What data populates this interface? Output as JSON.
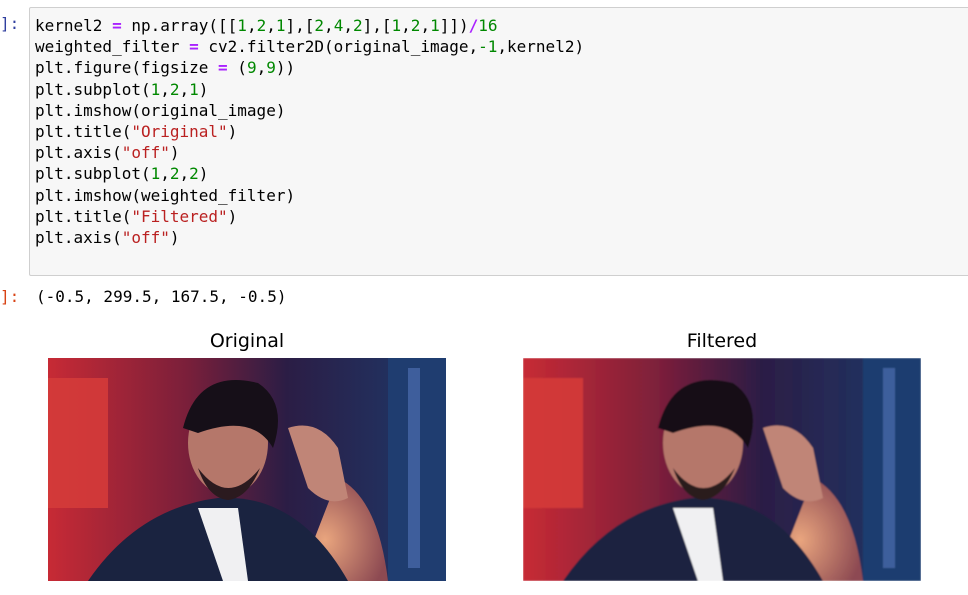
{
  "cell": {
    "in_prompt": "]:",
    "out_prompt": "]:",
    "code_lines": [
      [
        {
          "t": "kernel2 ",
          "c": "plain"
        },
        {
          "t": "=",
          "c": "op"
        },
        {
          "t": " np.array([[",
          "c": "plain"
        },
        {
          "t": "1",
          "c": "num"
        },
        {
          "t": ",",
          "c": "plain"
        },
        {
          "t": "2",
          "c": "num"
        },
        {
          "t": ",",
          "c": "plain"
        },
        {
          "t": "1",
          "c": "num"
        },
        {
          "t": "],[",
          "c": "plain"
        },
        {
          "t": "2",
          "c": "num"
        },
        {
          "t": ",",
          "c": "plain"
        },
        {
          "t": "4",
          "c": "num"
        },
        {
          "t": ",",
          "c": "plain"
        },
        {
          "t": "2",
          "c": "num"
        },
        {
          "t": "],[",
          "c": "plain"
        },
        {
          "t": "1",
          "c": "num"
        },
        {
          "t": ",",
          "c": "plain"
        },
        {
          "t": "2",
          "c": "num"
        },
        {
          "t": ",",
          "c": "plain"
        },
        {
          "t": "1",
          "c": "num"
        },
        {
          "t": "]])",
          "c": "plain"
        },
        {
          "t": "/",
          "c": "op"
        },
        {
          "t": "16",
          "c": "num"
        }
      ],
      [
        {
          "t": "weighted_filter ",
          "c": "plain"
        },
        {
          "t": "=",
          "c": "op"
        },
        {
          "t": " cv2.filter2D(original_image,",
          "c": "plain"
        },
        {
          "t": "-1",
          "c": "num"
        },
        {
          "t": ",kernel2)",
          "c": "plain"
        }
      ],
      [
        {
          "t": "plt.figure(figsize ",
          "c": "plain"
        },
        {
          "t": "=",
          "c": "op"
        },
        {
          "t": " (",
          "c": "plain"
        },
        {
          "t": "9",
          "c": "num"
        },
        {
          "t": ",",
          "c": "plain"
        },
        {
          "t": "9",
          "c": "num"
        },
        {
          "t": "))",
          "c": "plain"
        }
      ],
      [
        {
          "t": "plt.subplot(",
          "c": "plain"
        },
        {
          "t": "1",
          "c": "num"
        },
        {
          "t": ",",
          "c": "plain"
        },
        {
          "t": "2",
          "c": "num"
        },
        {
          "t": ",",
          "c": "plain"
        },
        {
          "t": "1",
          "c": "num"
        },
        {
          "t": ")",
          "c": "plain"
        }
      ],
      [
        {
          "t": "plt.imshow(original_image)",
          "c": "plain"
        }
      ],
      [
        {
          "t": "plt.title(",
          "c": "plain"
        },
        {
          "t": "\"Original\"",
          "c": "str"
        },
        {
          "t": ")",
          "c": "plain"
        }
      ],
      [
        {
          "t": "plt.axis(",
          "c": "plain"
        },
        {
          "t": "\"off\"",
          "c": "str"
        },
        {
          "t": ")",
          "c": "plain"
        }
      ],
      [
        {
          "t": "plt.subplot(",
          "c": "plain"
        },
        {
          "t": "1",
          "c": "num"
        },
        {
          "t": ",",
          "c": "plain"
        },
        {
          "t": "2",
          "c": "num"
        },
        {
          "t": ",",
          "c": "plain"
        },
        {
          "t": "2",
          "c": "num"
        },
        {
          "t": ")",
          "c": "plain"
        }
      ],
      [
        {
          "t": "plt.imshow(weighted_filter)",
          "c": "plain"
        }
      ],
      [
        {
          "t": "plt.title(",
          "c": "plain"
        },
        {
          "t": "\"Filtered\"",
          "c": "str"
        },
        {
          "t": ")",
          "c": "plain"
        }
      ],
      [
        {
          "t": "plt.axis(",
          "c": "plain"
        },
        {
          "t": "\"off\"",
          "c": "str"
        },
        {
          "t": ")",
          "c": "plain"
        }
      ]
    ],
    "output_text": "(-0.5, 299.5, 167.5, -0.5)"
  },
  "figure": {
    "left_title": "Original",
    "right_title": "Filtered"
  },
  "colors": {
    "prompt_in": "#303f9f",
    "prompt_out": "#d84315",
    "code_bg": "#f7f7f7",
    "op": "#aa22ff",
    "num": "#008800",
    "str": "#ba2121"
  }
}
